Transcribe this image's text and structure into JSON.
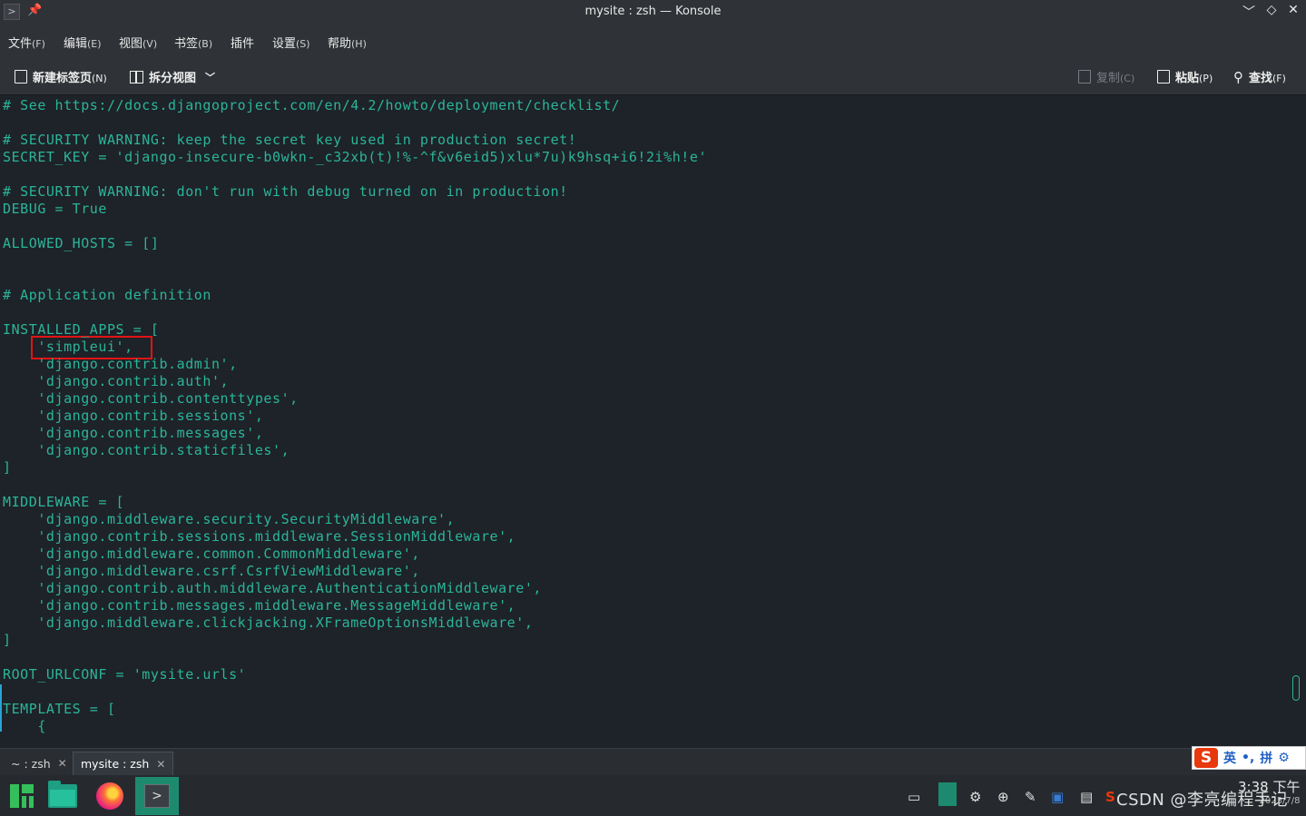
{
  "window": {
    "title": "mysite : zsh — Konsole",
    "buttons": [
      "﹀",
      "◇",
      "✕"
    ]
  },
  "menu": [
    {
      "label": "文件",
      "key": "(F)"
    },
    {
      "label": "编辑",
      "key": "(E)"
    },
    {
      "label": "视图",
      "key": "(V)"
    },
    {
      "label": "书签",
      "key": "(B)"
    },
    {
      "label": "插件",
      "key": ""
    },
    {
      "label": "设置",
      "key": "(S)"
    },
    {
      "label": "帮助",
      "key": "(H)"
    }
  ],
  "toolbar": {
    "new_tab": "新建标签页",
    "new_tab_key": "(N)",
    "split_view": "拆分视图",
    "copy": "复制",
    "copy_key": "(C)",
    "paste": "粘贴",
    "paste_key": "(P)",
    "find": "查找",
    "find_key": "(F)"
  },
  "terminal_lines": [
    "# See https://docs.djangoproject.com/en/4.2/howto/deployment/checklist/",
    "",
    "# SECURITY WARNING: keep the secret key used in production secret!",
    "SECRET_KEY = 'django-insecure-b0wkn-_c32xb(t)!%-^f&v6eid5)xlu*7u)k9hsq+i6!2i%h!e'",
    "",
    "# SECURITY WARNING: don't run with debug turned on in production!",
    "DEBUG = True",
    "",
    "ALLOWED_HOSTS = []",
    "",
    "",
    "# Application definition",
    "",
    "INSTALLED_APPS = [",
    "    'simpleui',",
    "    'django.contrib.admin',",
    "    'django.contrib.auth',",
    "    'django.contrib.contenttypes',",
    "    'django.contrib.sessions',",
    "    'django.contrib.messages',",
    "    'django.contrib.staticfiles',",
    "]",
    "",
    "MIDDLEWARE = [",
    "    'django.middleware.security.SecurityMiddleware',",
    "    'django.contrib.sessions.middleware.SessionMiddleware',",
    "    'django.middleware.common.CommonMiddleware',",
    "    'django.middleware.csrf.CsrfViewMiddleware',",
    "    'django.contrib.auth.middleware.AuthenticationMiddleware',",
    "    'django.contrib.messages.middleware.MessageMiddleware',",
    "    'django.middleware.clickjacking.XFrameOptionsMiddleware',",
    "]",
    "",
    "ROOT_URLCONF = 'mysite.urls'",
    "",
    "TEMPLATES = [",
    "    {"
  ],
  "tabs": [
    {
      "label": "~ : zsh",
      "close": "✕"
    },
    {
      "label": "mysite : zsh",
      "close": "✕"
    }
  ],
  "ime": {
    "logo": "S",
    "mode": "英",
    "punct": "•,",
    "input": "拼",
    "settings": "⚙"
  },
  "taskbar": {
    "clock_time": "3:38 下午",
    "clock_date": "2023/7/8",
    "watermark": "CSDN @李亮编程手记"
  },
  "colors": {
    "terminal_fg": "#2bb598",
    "terminal_bg": "#1e2229",
    "highlight_box": "#e11414"
  }
}
